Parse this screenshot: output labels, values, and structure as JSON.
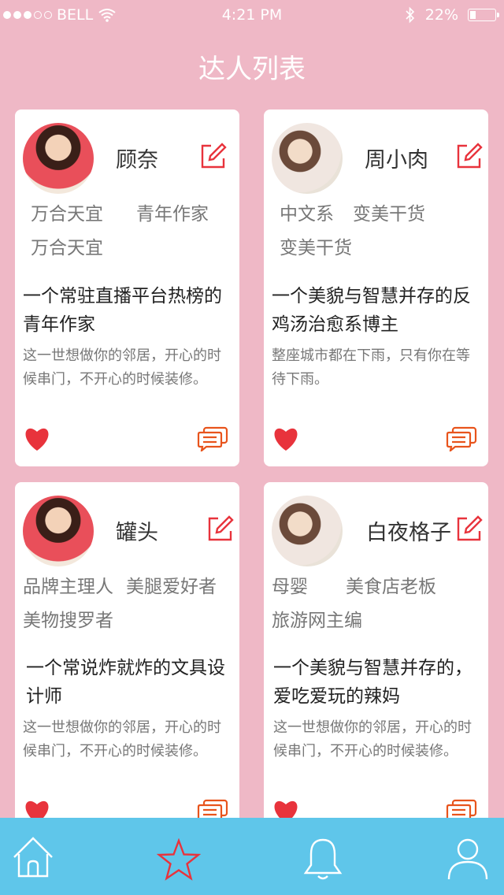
{
  "status_bar": {
    "carrier": "BELL",
    "time": "4:21 PM",
    "battery": "22%",
    "battery_level": 0.22
  },
  "title": "达人列表",
  "cards": [
    {
      "name": "顾奈",
      "tags": [
        "万合天宜",
        "青年作家",
        "万合天宜"
      ],
      "headline": "一个常驻直播平台热榜的青年作家",
      "description": "这一世想做你的邻居，开心的时候串门，不开心的时候装修。"
    },
    {
      "name": "周小肉",
      "tags": [
        "中文系",
        "变美干货",
        "变美干货"
      ],
      "headline": "一个美貌与智慧并存的反鸡汤治愈系博主",
      "description": "整座城市都在下雨，只有你在等待下雨。"
    },
    {
      "name": "罐头",
      "tags": [
        "品牌主理人",
        "美腿爱好者",
        "美物搜罗者"
      ],
      "headline": "一个常说炸就炸的文具设计师",
      "description": "这一世想做你的邻居，开心的时候串门，不开心的时候装修。"
    },
    {
      "name": "白夜格子",
      "tags": [
        "母婴",
        "美食店老板",
        "旅游网主编"
      ],
      "headline": "一个美貌与智慧并存的，爱吃爱玩的辣妈",
      "description": "这一世想做你的邻居，开心的时候串门，不开心的时候装修。"
    }
  ],
  "colors": {
    "background": "#efb8c6",
    "accent_red": "#e8333c",
    "comment_orange": "#e8541c",
    "tab_bar": "#5fc6ea"
  },
  "tab_bar": {
    "items": [
      {
        "icon": "home-icon"
      },
      {
        "icon": "star-icon",
        "active": true
      },
      {
        "icon": "bell-icon"
      },
      {
        "icon": "user-icon"
      }
    ]
  }
}
